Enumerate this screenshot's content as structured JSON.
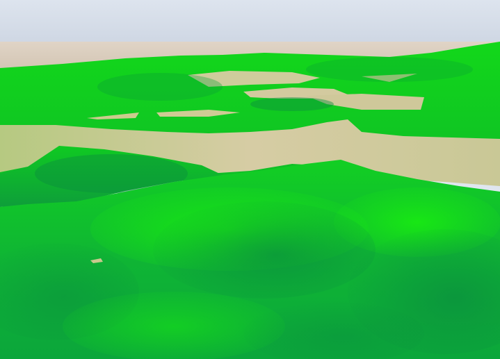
{
  "scene": {
    "type": "3d-terrain-view",
    "colors": {
      "sky_top": "#dde4ee",
      "sky_bottom": "#cfd6e3",
      "horizon_ground": "#d8c9b8",
      "terrain_bright": "#12dc12",
      "terrain_mid": "#0fbf2a",
      "terrain_dark": "#0b8f3a",
      "flat_tan": "#cfc89a",
      "flat_olive": "#b8c98a"
    }
  }
}
